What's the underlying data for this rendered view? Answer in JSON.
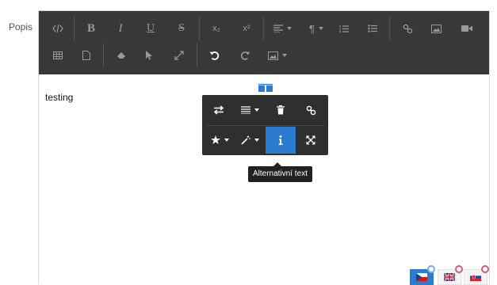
{
  "field": {
    "label": "Popis"
  },
  "toolbar": {
    "row1": [
      "code-view",
      "bold",
      "italic",
      "underline",
      "strikethrough",
      "subscript",
      "superscript",
      "paragraph-align",
      "paragraph-style",
      "ordered-list",
      "unordered-list",
      "link",
      "image",
      "video"
    ],
    "row2": [
      "table",
      "document",
      "eraser",
      "pointer",
      "fullscreen",
      "undo",
      "redo",
      "image-insert"
    ],
    "labels": {
      "bold": "B",
      "italic": "I",
      "underline": "U",
      "strike": "S",
      "sub": "x₂",
      "sup": "x²"
    }
  },
  "content": {
    "text": "testing"
  },
  "image_popover": {
    "row1": [
      "swap-image",
      "align-image",
      "delete-image",
      "link-image"
    ],
    "row2": [
      "style-image",
      "edit-image",
      "alt-text",
      "resize-image"
    ],
    "active": "alt-text"
  },
  "tooltip": {
    "text": "Alternativní text"
  },
  "languages": {
    "items": [
      {
        "code": "cs",
        "active": true
      },
      {
        "code": "en",
        "active": false
      },
      {
        "code": "sk",
        "active": false
      }
    ],
    "accent": "#2b7bd1"
  }
}
